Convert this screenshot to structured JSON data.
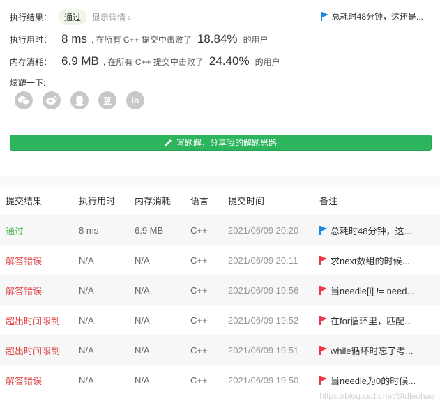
{
  "summary": {
    "result_label": "执行结果：",
    "result_value": "通过",
    "show_detail": "显示详情 ›",
    "top_note": "总耗时48分钟，这还是...",
    "time_label": "执行用时：",
    "time_value": "8 ms",
    "time_middle": ", 在所有 C++ 提交中击败了",
    "time_pct": "18.84%",
    "time_suffix": "的用户",
    "mem_label": "内存消耗：",
    "mem_value": "6.9 MB",
    "mem_middle": ", 在所有 C++ 提交中击败了",
    "mem_pct": "24.40%",
    "mem_suffix": "的用户",
    "share_label": "炫耀一下:",
    "share_icons": [
      "wechat-icon",
      "weibo-icon",
      "qq-icon",
      "douban-icon",
      "linkedin-icon"
    ],
    "share_glyphs": [
      "",
      "",
      "",
      "豆",
      "in"
    ],
    "solution_button": "写题解，分享我的解题思路"
  },
  "table": {
    "headers": [
      "提交结果",
      "执行用时",
      "内存消耗",
      "语言",
      "提交时间",
      "备注"
    ],
    "rows": [
      {
        "status": "通过",
        "time": "8 ms",
        "memory": "6.9 MB",
        "lang": "C++",
        "submitted": "2021/06/09 20:20",
        "note": "总耗时48分钟，这...",
        "flag": "blue"
      },
      {
        "status": "解答错误",
        "time": "N/A",
        "memory": "N/A",
        "lang": "C++",
        "submitted": "2021/06/09 20:11",
        "note": "求next数组的时候...",
        "flag": "red"
      },
      {
        "status": "解答错误",
        "time": "N/A",
        "memory": "N/A",
        "lang": "C++",
        "submitted": "2021/06/09 19:56",
        "note": "当needle[i] != need...",
        "flag": "red"
      },
      {
        "status": "超出时间限制",
        "time": "N/A",
        "memory": "N/A",
        "lang": "C++",
        "submitted": "2021/06/09 19:52",
        "note": "在for循环里，匹配...",
        "flag": "red"
      },
      {
        "status": "超出时间限制",
        "time": "N/A",
        "memory": "N/A",
        "lang": "C++",
        "submitted": "2021/06/09 19:51",
        "note": "while循环时忘了考...",
        "flag": "red"
      },
      {
        "status": "解答错误",
        "time": "N/A",
        "memory": "N/A",
        "lang": "C++",
        "submitted": "2021/06/09 19:50",
        "note": "当needle为0的时候...",
        "flag": "red"
      }
    ]
  },
  "colors": {
    "accent_green": "#2db55d",
    "ok": "#5cb85c",
    "error": "#e04848",
    "flag_blue": "#1e88e5",
    "flag_red": "#f0364a"
  },
  "watermark": "https://blog.csdn.net/Stdleohao"
}
